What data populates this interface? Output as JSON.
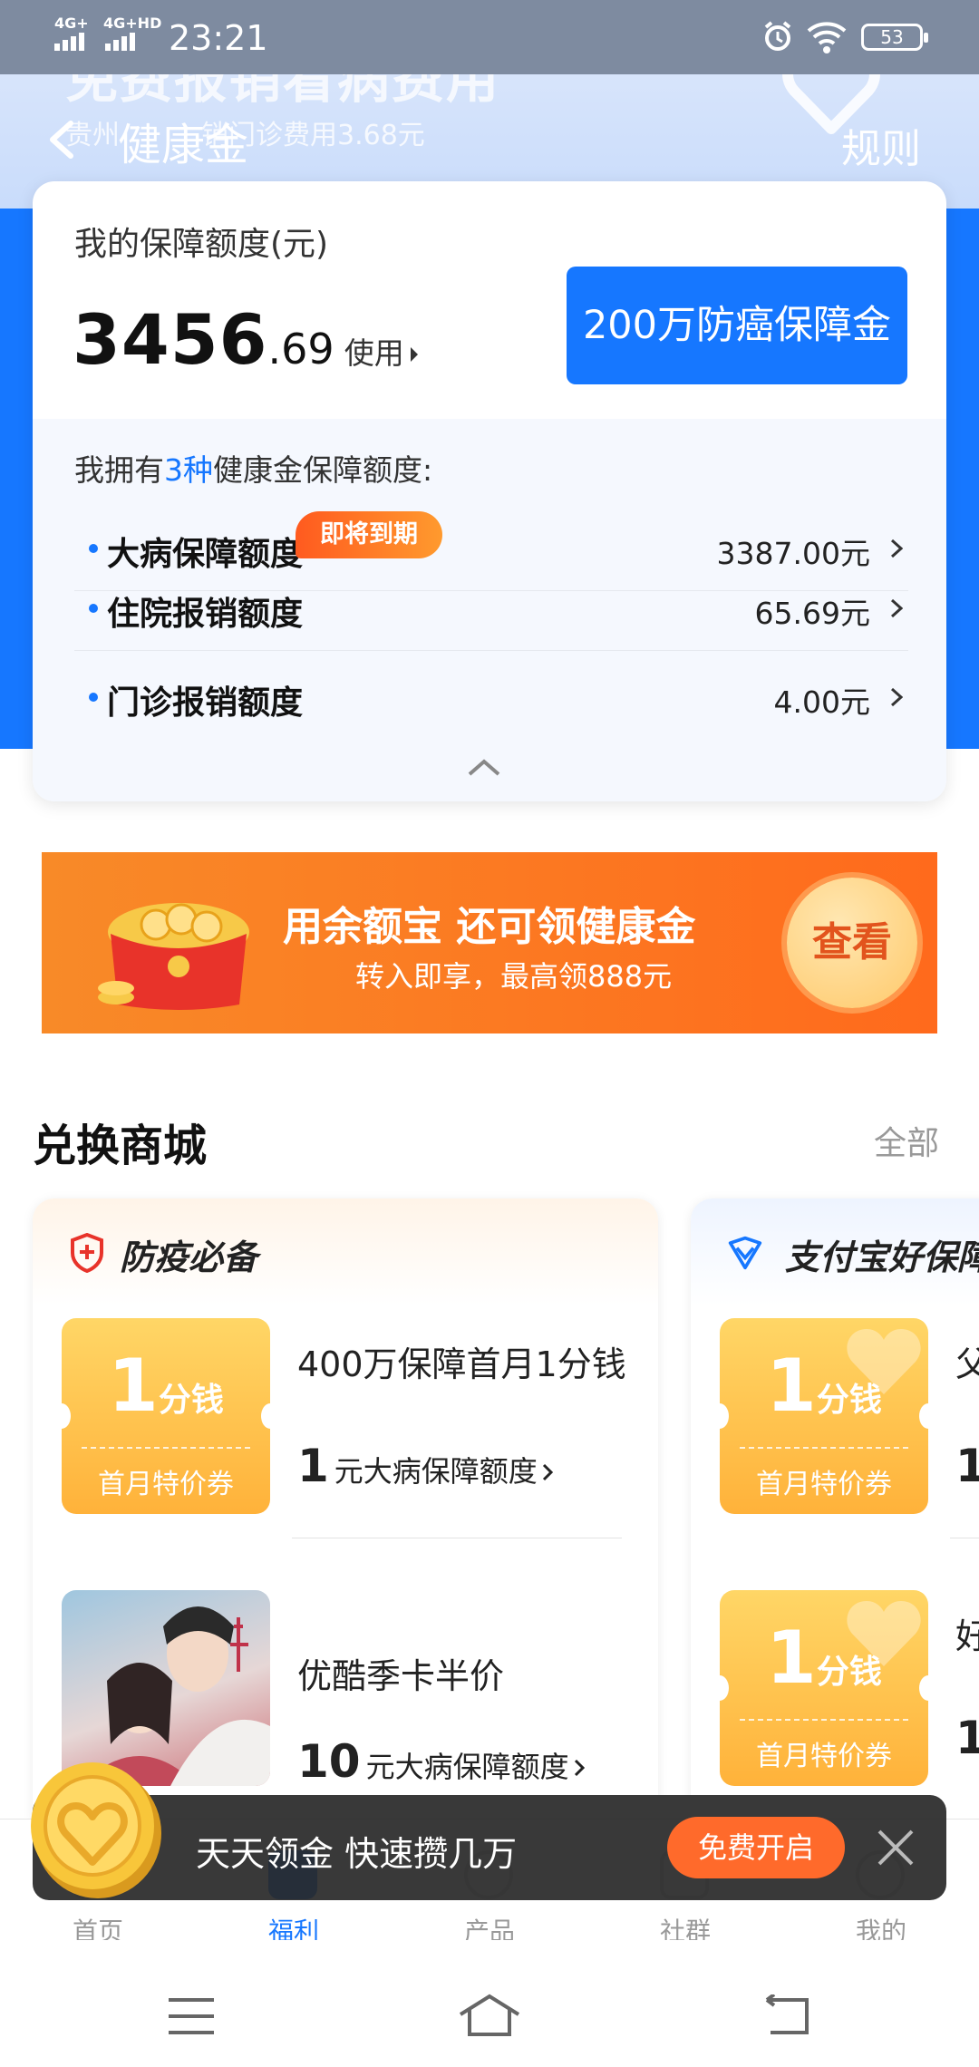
{
  "status_bar": {
    "net1": "4G+",
    "net2": "4G+HD",
    "time": "23:21",
    "battery": "53"
  },
  "hero": {
    "ghost_title": "免费报销看病费用",
    "ghost_sub_prefix": "贵州",
    "ghost_sub_amount": "销门诊费用3.68元",
    "nav_title": "健康金",
    "rules_label": "规则"
  },
  "card": {
    "label": "我的保障额度(元)",
    "amount_int": "3456",
    "amount_dec": ".69",
    "use_label": "使用",
    "cancer_button": "200万防癌保障金",
    "own_prefix": "我拥有",
    "own_count": "3种",
    "own_suffix": "健康金保障额度:",
    "rows": [
      {
        "name": "大病保障额度",
        "value": "3387.00元"
      },
      {
        "name": "住院报销额度",
        "value": "65.69元"
      },
      {
        "name": "门诊报销额度",
        "value": "4.00元"
      }
    ],
    "expire_badge": "即将到期"
  },
  "banner": {
    "title": "用余额宝 还可领健康金",
    "subtitle": "转入即享，最高领888元",
    "button": "查看"
  },
  "mall": {
    "title": "兑换商城",
    "all_link": "全部",
    "panels": [
      {
        "name": "防疫必备",
        "items": [
          {
            "coupon_num": "1",
            "coupon_unit": "分钱",
            "coupon_sub": "首月特价券",
            "title": "400万保障首月1分钱",
            "amount": "1",
            "amount_text": "元大病保障额度"
          },
          {
            "title": "优酷季卡半价",
            "amount": "10",
            "amount_text": "元大病保障额度"
          }
        ]
      },
      {
        "name": "支付宝好保障",
        "items": [
          {
            "coupon_num": "1",
            "coupon_unit": "分钱",
            "coupon_sub": "首月特价券",
            "title": "父",
            "amount": "1"
          },
          {
            "coupon_num": "1",
            "coupon_unit": "分钱",
            "coupon_sub": "首月特价券",
            "title": "好",
            "amount": "1"
          }
        ]
      }
    ]
  },
  "promo": {
    "text": "天天领金 快速攒几万",
    "button": "免费开启"
  },
  "tabs": [
    {
      "label": "首页"
    },
    {
      "label": "福利",
      "active": true
    },
    {
      "label": "产品"
    },
    {
      "label": "社群"
    },
    {
      "label": "我的"
    }
  ],
  "colors": {
    "accent": "#1677ff",
    "orange": "#ff6a2b",
    "coupon": "#ffb23a"
  }
}
